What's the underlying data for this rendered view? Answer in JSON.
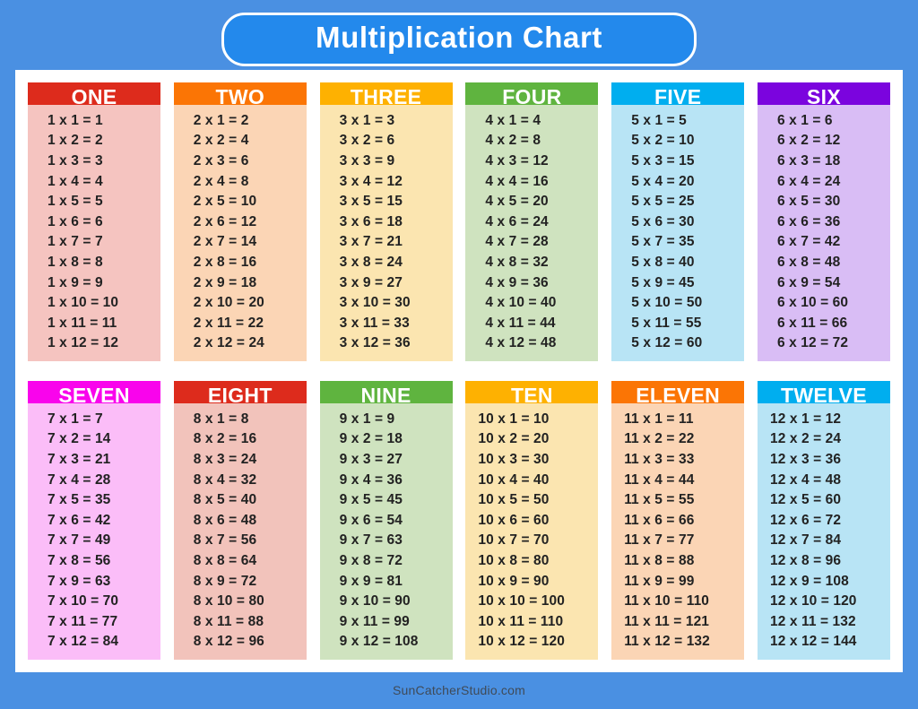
{
  "page": {
    "background_color": "#4a90e2",
    "card_color": "#ffffff"
  },
  "header": {
    "title": "Multiplication Chart",
    "pill_color": "#2389ec",
    "pill_border_color": "#ffffff",
    "title_color": "#ffffff"
  },
  "footer": {
    "text": "SunCatcherStudio.com",
    "color": "#3f4a57"
  },
  "chart_data": {
    "type": "table",
    "title": "Multiplication Chart",
    "description": "Twelve multiplication tables, each listing products of the table number with multipliers 1 through 12.",
    "multiplier_range": [
      1,
      12
    ],
    "layout": {
      "rows": 2,
      "columns": 6
    },
    "tables": [
      {
        "name": "ONE",
        "base": 1,
        "header_color": "#dd2b1c",
        "body_color": "#f5c4c0",
        "rows": [
          "1 x 1 = 1",
          "1 x 2 = 2",
          "1 x 3 = 3",
          "1 x 4 = 4",
          "1 x 5 = 5",
          "1 x 6 = 6",
          "1 x 7 = 7",
          "1 x 8 = 8",
          "1 x 9 = 9",
          "1 x 10 = 10",
          "1 x 11 = 11",
          "1 x 12 = 12"
        ],
        "products": [
          1,
          2,
          3,
          4,
          5,
          6,
          7,
          8,
          9,
          10,
          11,
          12
        ]
      },
      {
        "name": "TWO",
        "base": 2,
        "header_color": "#fb7505",
        "body_color": "#fbd5b5",
        "rows": [
          "2 x 1 = 2",
          "2 x 2 = 4",
          "2 x 3 = 6",
          "2 x 4 = 8",
          "2 x 5 = 10",
          "2 x 6 = 12",
          "2 x 7 = 14",
          "2 x 8 = 16",
          "2 x 9 = 18",
          "2 x 10 = 20",
          "2 x 11 = 22",
          "2 x 12 = 24"
        ],
        "products": [
          2,
          4,
          6,
          8,
          10,
          12,
          14,
          16,
          18,
          20,
          22,
          24
        ]
      },
      {
        "name": "THREE",
        "base": 3,
        "header_color": "#feb101",
        "body_color": "#fbe5b0",
        "rows": [
          "3 x 1 = 3",
          "3 x 2 = 6",
          "3 x 3 = 9",
          "3 x 4 = 12",
          "3 x 5 = 15",
          "3 x 6 = 18",
          "3 x 7 = 21",
          "3 x 8 = 24",
          "3 x 9 = 27",
          "3 x 10 = 30",
          "3 x 11 = 33",
          "3 x 12 = 36"
        ],
        "products": [
          3,
          6,
          9,
          12,
          15,
          18,
          21,
          24,
          27,
          30,
          33,
          36
        ]
      },
      {
        "name": "FOUR",
        "base": 4,
        "header_color": "#5fb43f",
        "body_color": "#cfe3bf",
        "rows": [
          "4 x 1 = 4",
          "4 x 2 = 8",
          "4 x 3 = 12",
          "4 x 4 = 16",
          "4 x 5 = 20",
          "4 x 6 = 24",
          "4 x 7 = 28",
          "4 x 8 = 32",
          "4 x 9 = 36",
          "4 x 10 = 40",
          "4 x 11 = 44",
          "4 x 12 = 48"
        ],
        "products": [
          4,
          8,
          12,
          16,
          20,
          24,
          28,
          32,
          36,
          40,
          44,
          48
        ]
      },
      {
        "name": "FIVE",
        "base": 5,
        "header_color": "#00aeef",
        "body_color": "#b8e4f5",
        "rows": [
          "5 x 1 = 5",
          "5 x 2 = 10",
          "5 x 3 = 15",
          "5 x 4 = 20",
          "5 x 5 = 25",
          "5 x 6 = 30",
          "5 x 7 = 35",
          "5 x 8 = 40",
          "5 x 9 = 45",
          "5 x 10 = 50",
          "5 x 11 = 55",
          "5 x 12 = 60"
        ],
        "products": [
          5,
          10,
          15,
          20,
          25,
          30,
          35,
          40,
          45,
          50,
          55,
          60
        ]
      },
      {
        "name": "SIX",
        "base": 6,
        "header_color": "#7b04de",
        "body_color": "#d9bdf5",
        "rows": [
          "6 x 1 = 6",
          "6 x 2 = 12",
          "6 x 3 = 18",
          "6 x 4 = 24",
          "6 x 5 = 30",
          "6 x 6 = 36",
          "6 x 7 = 42",
          "6 x 8 = 48",
          "6 x 9 = 54",
          "6 x 10 = 60",
          "6 x 11 = 66",
          "6 x 12 = 72"
        ],
        "products": [
          6,
          12,
          18,
          24,
          30,
          36,
          42,
          48,
          54,
          60,
          66,
          72
        ]
      },
      {
        "name": "SEVEN",
        "base": 7,
        "header_color": "#f904ec",
        "body_color": "#fbbdf8",
        "rows": [
          "7 x 1 = 7",
          "7 x 2 = 14",
          "7 x 3 = 21",
          "7 x 4 = 28",
          "7 x 5 = 35",
          "7 x 6 = 42",
          "7 x 7 = 49",
          "7 x 8 = 56",
          "7 x 9 = 63",
          "7 x 10 = 70",
          "7 x 11 = 77",
          "7 x 12 = 84"
        ],
        "products": [
          7,
          14,
          21,
          28,
          35,
          42,
          49,
          56,
          63,
          70,
          77,
          84
        ]
      },
      {
        "name": "EIGHT",
        "base": 8,
        "header_color": "#dd2b1c",
        "body_color": "#f2c3bb",
        "rows": [
          "8 x 1 = 8",
          "8 x 2 = 16",
          "8 x 3 = 24",
          "8 x 4 = 32",
          "8 x 5 = 40",
          "8 x 6 = 48",
          "8 x 7 = 56",
          "8 x 8 = 64",
          "8 x 9 = 72",
          "8 x 10 = 80",
          "8 x 11 = 88",
          "8 x 12 = 96"
        ],
        "products": [
          8,
          16,
          24,
          32,
          40,
          48,
          56,
          64,
          72,
          80,
          88,
          96
        ]
      },
      {
        "name": "NINE",
        "base": 9,
        "header_color": "#5fb43f",
        "body_color": "#cfe3bf",
        "rows": [
          "9 x 1 = 9",
          "9 x 2 = 18",
          "9 x 3 = 27",
          "9 x 4 = 36",
          "9 x 5 = 45",
          "9 x 6 = 54",
          "9 x 7 = 63",
          "9 x 8 = 72",
          "9 x 9 = 81",
          "9 x 10 = 90",
          "9 x 11 = 99",
          "9 x 12 = 108"
        ],
        "products": [
          9,
          18,
          27,
          36,
          45,
          54,
          63,
          72,
          81,
          90,
          99,
          108
        ]
      },
      {
        "name": "TEN",
        "base": 10,
        "header_color": "#feb101",
        "body_color": "#fbe5b0",
        "rows": [
          "10 x 1 = 10",
          "10 x 2 = 20",
          "10 x 3 = 30",
          "10 x 4 = 40",
          "10 x 5 = 50",
          "10 x 6 = 60",
          "10 x 7 = 70",
          "10 x 8 = 80",
          "10 x 9 = 90",
          "10 x 10 = 100",
          "10 x 11 = 110",
          "10 x 12 = 120"
        ],
        "products": [
          10,
          20,
          30,
          40,
          50,
          60,
          70,
          80,
          90,
          100,
          110,
          120
        ]
      },
      {
        "name": "ELEVEN",
        "base": 11,
        "header_color": "#fb7505",
        "body_color": "#fbd5b5",
        "rows": [
          "11 x 1 = 11",
          "11 x 2 = 22",
          "11 x 3 = 33",
          "11 x 4 = 44",
          "11 x 5 = 55",
          "11 x 6 = 66",
          "11 x 7 = 77",
          "11 x 8 = 88",
          "11 x 9 = 99",
          "11 x 10 = 110",
          "11 x 11 = 121",
          "11 x 12 = 132"
        ],
        "products": [
          11,
          22,
          33,
          44,
          55,
          66,
          77,
          88,
          99,
          110,
          121,
          132
        ]
      },
      {
        "name": "TWELVE",
        "base": 12,
        "header_color": "#00aeef",
        "body_color": "#b8e4f5",
        "rows": [
          "12 x 1 = 12",
          "12 x 2 = 24",
          "12 x 3 = 36",
          "12 x 4 = 48",
          "12 x 5 = 60",
          "12 x 6 = 72",
          "12 x 7 = 84",
          "12 x 8 = 96",
          "12 x 9 = 108",
          "12 x 10 = 120",
          "12 x 11 = 132",
          "12 x 12 = 144"
        ],
        "products": [
          12,
          24,
          36,
          48,
          60,
          72,
          84,
          96,
          108,
          120,
          132,
          144
        ]
      }
    ]
  }
}
